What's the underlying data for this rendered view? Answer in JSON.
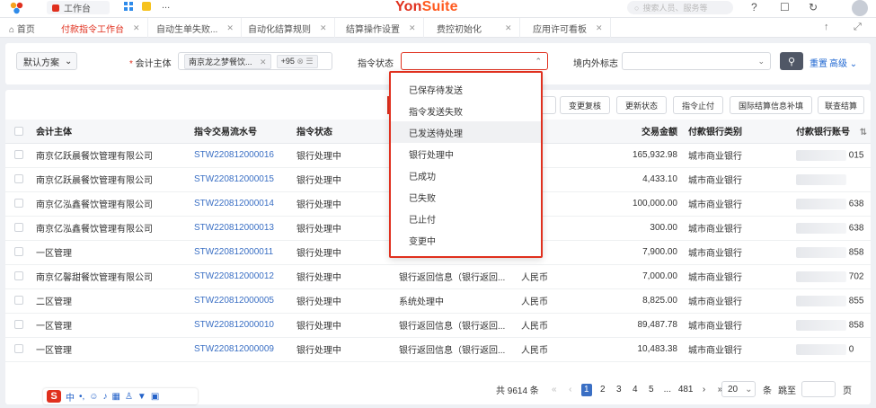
{
  "topbar": {
    "workbench_label": "工作台",
    "more_label": "...",
    "brand_prefix": "Yon",
    "brand_suffix": "Suite",
    "search_placeholder": "搜索人员、服务等",
    "help_icon": "?",
    "chat_icon": "☐",
    "share_icon": "↻"
  },
  "tabs": {
    "home_label": "首页",
    "items": [
      {
        "label": "付款指令工作台"
      },
      {
        "label": "自动生单失败..."
      },
      {
        "label": "自动化结算规则"
      },
      {
        "label": "结算操作设置"
      },
      {
        "label": "费控初始化"
      },
      {
        "label": "应用许可看板"
      }
    ]
  },
  "filter": {
    "scheme_label": "默认方案",
    "entity_label": "会计主体",
    "entity_value": "南京龙之梦餐饮...",
    "entity_more": "+95",
    "status_label": "指令状态",
    "domestic_label": "境内外标志",
    "reset_label": "重置",
    "advanced_label": "高级"
  },
  "actions": [
    "变更复核",
    "更新状态",
    "指令止付",
    "国际结算信息补填",
    "联查结算"
  ],
  "table": {
    "headers": {
      "entity": "会计主体",
      "serial": "指令交易流水号",
      "status": "指令状态",
      "amount": "交易金额",
      "bank_type": "付款银行类别",
      "account": "付款银行账号"
    },
    "rows": [
      {
        "entity": "南京亿跃晨餐饮管理有限公司",
        "serial": "STW220812000016",
        "status": "银行处理中",
        "info": "",
        "currency": "",
        "amount": "165,932.98",
        "bank_type": "城市商业银行",
        "account": "015"
      },
      {
        "entity": "南京亿跃晨餐饮管理有限公司",
        "serial": "STW220812000015",
        "status": "银行处理中",
        "info": "",
        "currency": "",
        "amount": "4,433.10",
        "bank_type": "城市商业银行",
        "account": ""
      },
      {
        "entity": "南京亿泓鑫餐饮管理有限公司",
        "serial": "STW220812000014",
        "status": "银行处理中",
        "info": "",
        "currency": "",
        "amount": "100,000.00",
        "bank_type": "城市商业银行",
        "account": "638"
      },
      {
        "entity": "南京亿泓鑫餐饮管理有限公司",
        "serial": "STW220812000013",
        "status": "银行处理中",
        "info": "",
        "currency": "",
        "amount": "300.00",
        "bank_type": "城市商业银行",
        "account": "638"
      },
      {
        "entity": "一区管理",
        "serial": "STW220812000011",
        "status": "银行处理中",
        "info": "",
        "currency": "",
        "amount": "7,900.00",
        "bank_type": "城市商业银行",
        "account": "858"
      },
      {
        "entity": "南京亿馨甜餐饮管理有限公司",
        "serial": "STW220812000012",
        "status": "银行处理中",
        "info": "银行返回信息（银行返回...",
        "currency": "人民币",
        "amount": "7,000.00",
        "bank_type": "城市商业银行",
        "account": "702"
      },
      {
        "entity": "二区管理",
        "serial": "STW220812000005",
        "status": "银行处理中",
        "info": "系统处理中",
        "currency": "人民币",
        "amount": "8,825.00",
        "bank_type": "城市商业银行",
        "account": "855"
      },
      {
        "entity": "一区管理",
        "serial": "STW220812000010",
        "status": "银行处理中",
        "info": "银行返回信息（银行返回...",
        "currency": "人民币",
        "amount": "89,487.78",
        "bank_type": "城市商业银行",
        "account": "858"
      },
      {
        "entity": "一区管理",
        "serial": "STW220812000009",
        "status": "银行处理中",
        "info": "银行返回信息（银行返回...",
        "currency": "人民币",
        "amount": "10,483.38",
        "bank_type": "城市商业银行",
        "account": "0"
      }
    ]
  },
  "dropdown": {
    "options": [
      "已保存待发送",
      "指令发送失败",
      "已发送待处理",
      "银行处理中",
      "已成功",
      "已失败",
      "已止付",
      "变更中"
    ],
    "highlighted": "已发送待处理"
  },
  "pager": {
    "total_label": "共 9614 条",
    "pages": [
      "1",
      "2",
      "3",
      "4",
      "5",
      "...",
      "481"
    ],
    "current": "1",
    "page_size": "20",
    "unit_label": "条",
    "jump_label": "跳至",
    "page_label": "页"
  },
  "ime": {
    "brand": "S",
    "mode": "中"
  },
  "colors": {
    "accent": "#e0301e",
    "link": "#3a6fc4",
    "primary_button": "#505766"
  }
}
